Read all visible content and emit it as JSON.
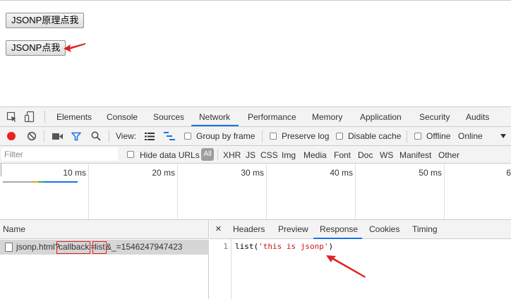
{
  "page": {
    "button_principle": "JSONP原理点我",
    "button_click": "JSONP点我"
  },
  "devtools": {
    "tabs": [
      "Elements",
      "Console",
      "Sources",
      "Network",
      "Performance",
      "Memory",
      "Application",
      "Security",
      "Audits"
    ],
    "active_tab": "Network",
    "toolbar": {
      "view_label": "View:",
      "group_by_frame": "Group by frame",
      "preserve_log": "Preserve log",
      "disable_cache": "Disable cache",
      "offline": "Offline",
      "throttle": "Online"
    },
    "filter": {
      "placeholder": "Filter",
      "hide_data_urls": "Hide data URLs",
      "all": "All",
      "types": [
        "XHR",
        "JS",
        "CSS",
        "Img",
        "Media",
        "Font",
        "Doc",
        "WS",
        "Manifest",
        "Other"
      ]
    },
    "timeline": {
      "ticks": [
        "10 ms",
        "20 ms",
        "30 ms",
        "40 ms",
        "50 ms",
        "6"
      ]
    },
    "requests": {
      "header": "Name",
      "row": {
        "prefix": "jsonp.html?",
        "param": "callback",
        "eq": "=",
        "value": "list",
        "rest": "&_=1546247947423"
      }
    },
    "detail": {
      "close": "×",
      "tabs": [
        "Headers",
        "Preview",
        "Response",
        "Cookies",
        "Timing"
      ],
      "active_tab": "Response",
      "line_number": "1",
      "code_prefix": "list(",
      "code_string": "'this is jsonp'",
      "code_suffix": ")"
    },
    "colors": {
      "accent": "#1a73e8",
      "record": "#e8231c",
      "annotation": "#e02020"
    }
  }
}
